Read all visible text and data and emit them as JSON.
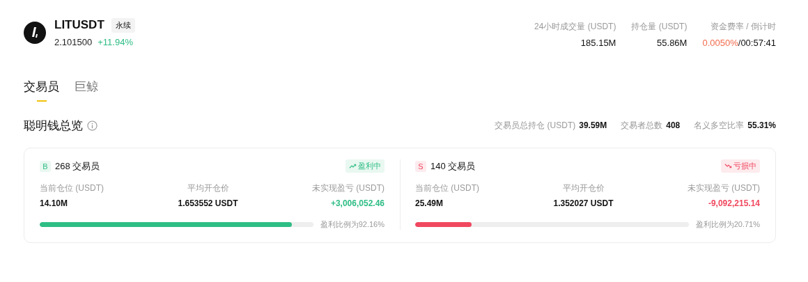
{
  "ticker": {
    "symbol": "LITUSDT",
    "badge": "永续",
    "price": "2.101500",
    "change": "+11.94%"
  },
  "market_stats": [
    {
      "label": "24小时成交量 (USDT)",
      "value": "185.15M"
    },
    {
      "label": "持仓量 (USDT)",
      "value": "55.86M"
    },
    {
      "label": "资金费率 / 倒计时",
      "rate": "0.0050%",
      "separator": "/",
      "countdown": "00:57:41"
    }
  ],
  "tabs": [
    {
      "label": "交易员",
      "selected": true
    },
    {
      "label": "巨鲸",
      "selected": false
    }
  ],
  "overview": {
    "title": "聪明钱总览",
    "stats": [
      {
        "label": "交易员总持仓 (USDT)",
        "value": "39.59M"
      },
      {
        "label": "交易者总数",
        "value": "408"
      },
      {
        "label": "名义多空比率",
        "value": "55.31%"
      }
    ]
  },
  "sides": [
    {
      "kind": "long",
      "tag": "B",
      "traders": "268 交易员",
      "status": "盈利中",
      "position_label": "当前仓位 (USDT)",
      "position": "14.10M",
      "avg_label": "平均开仓价",
      "avg": "1.653552 USDT",
      "pnl_label": "未实现盈亏 (USDT)",
      "pnl": "+3,006,052.46",
      "level": 0.9216,
      "ratio": "盈利比例为92.16%"
    },
    {
      "kind": "short",
      "tag": "S",
      "traders": "140 交易员",
      "status": "亏损中",
      "position_label": "当前仓位 (USDT)",
      "position": "25.49M",
      "avg_label": "平均开仓价",
      "avg": "1.352027 USDT",
      "pnl_label": "未实现盈亏 (USDT)",
      "pnl": "-9,092,215.14",
      "level": 0.2071,
      "ratio": "盈利比例为20.71%"
    }
  ]
}
